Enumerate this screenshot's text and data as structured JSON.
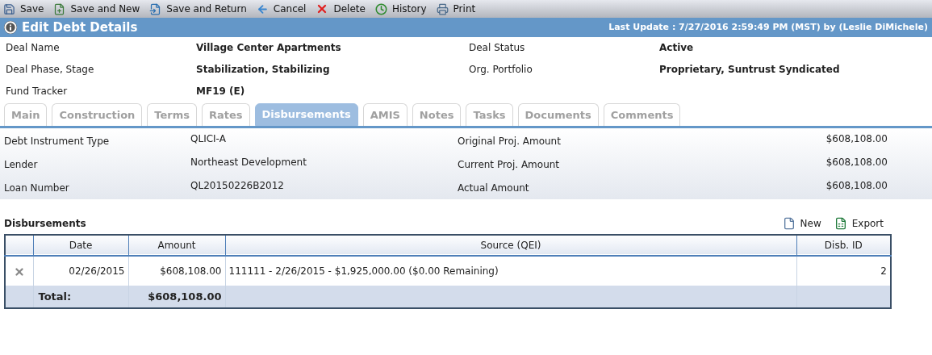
{
  "toolbar": [
    {
      "kind": "save",
      "label": "Save"
    },
    {
      "kind": "save_new",
      "label": "Save and New"
    },
    {
      "kind": "save_return",
      "label": "Save and Return"
    },
    {
      "kind": "cancel",
      "label": "Cancel"
    },
    {
      "kind": "delete",
      "label": "Delete"
    },
    {
      "kind": "history",
      "label": "History"
    },
    {
      "kind": "print",
      "label": "Print"
    }
  ],
  "header": {
    "title": "Edit Debt Details",
    "last_update": "Last Update : 7/27/2016 2:59:49 PM (MST) by (Leslie DiMichele)"
  },
  "deal_fields": [
    {
      "label": "Deal Name",
      "value": "Village Center Apartments"
    },
    {
      "label": "Deal Status",
      "value": "Active"
    },
    {
      "label": "Deal Phase, Stage",
      "value": "Stabilization, Stabilizing"
    },
    {
      "label": "Org. Portfolio",
      "value": "Proprietary, Suntrust Syndicated"
    },
    {
      "label": "Fund Tracker",
      "value": "MF19 (E)"
    }
  ],
  "tabs": [
    {
      "label": "Main",
      "selected": false
    },
    {
      "label": "Construction",
      "selected": false
    },
    {
      "label": "Terms",
      "selected": false
    },
    {
      "label": "Rates",
      "selected": false
    },
    {
      "label": "Disbursements",
      "selected": true
    },
    {
      "label": "AMIS",
      "selected": false
    },
    {
      "label": "Notes",
      "selected": false
    },
    {
      "label": "Tasks",
      "selected": false
    },
    {
      "label": "Documents",
      "selected": false
    },
    {
      "label": "Comments",
      "selected": false
    }
  ],
  "debt_fields": [
    {
      "label": "Debt Instrument Type",
      "value": "QLICI-A",
      "label_2": "Original Proj. Amount",
      "value_2": "$608,108.00"
    },
    {
      "label": "Lender",
      "value": "Northeast Development",
      "label_2": "Current Proj. Amount",
      "value_2": "$608,108.00"
    },
    {
      "label": "Loan Number",
      "value": "QL20150226B2012",
      "label_2": "Actual Amount",
      "value_2": "$608,108.00"
    }
  ],
  "disbursements": {
    "title": "Disbursements",
    "actions": [
      {
        "kind": "new",
        "label": "New"
      },
      {
        "kind": "export",
        "label": "Export"
      }
    ],
    "columns": [
      "Date",
      "Amount",
      "Source (QEI)",
      "Disb. ID"
    ],
    "rows": [
      [
        "02/26/2015",
        "$608,108.00",
        "111111 - 2/26/2015 - $1,925,000.00 ($0.00 Remaining)",
        "2"
      ]
    ],
    "total": {
      "label": "Total:",
      "amount": "$608,108.00"
    }
  }
}
